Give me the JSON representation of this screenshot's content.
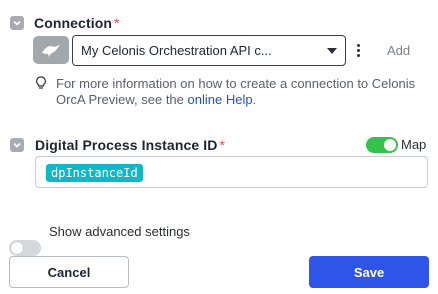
{
  "connection": {
    "label": "Connection",
    "required_mark": "*",
    "logo_icon": "orca-logo-icon",
    "selected_value": "My Celonis Orchestration API c...",
    "add_label": "Add",
    "help_prefix": "For more information on how to create a connection to Celonis OrcA Preview, see the ",
    "help_link": "online Help",
    "help_suffix": "."
  },
  "instance_id": {
    "label": "Digital Process Instance ID",
    "required_mark": "*",
    "map_label": "Map",
    "map_enabled": true,
    "token": "dpInstanceId"
  },
  "advanced": {
    "label": "Show advanced settings",
    "enabled": false
  },
  "actions": {
    "cancel_label": "Cancel",
    "save_label": "Save"
  },
  "colors": {
    "toggle_on": "#35c24a",
    "pill": "#10b7c9",
    "primary": "#2f54e8",
    "link": "#2150d8",
    "required": "#e5484d"
  }
}
